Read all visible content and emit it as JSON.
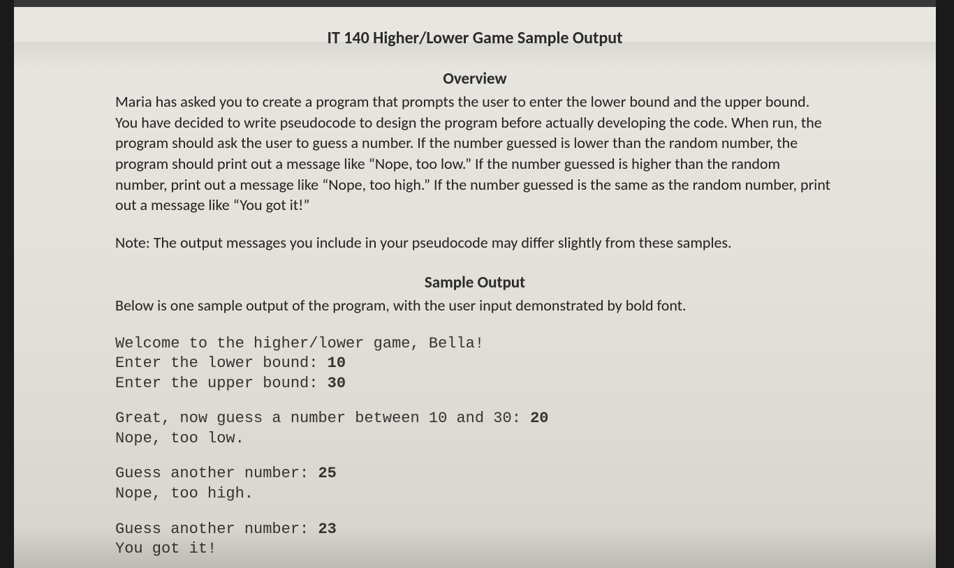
{
  "title": "IT 140 Higher/Lower Game Sample Output",
  "overview": {
    "heading": "Overview",
    "paragraph": "Maria has asked you to create a program that prompts the user to enter the lower bound and the upper bound. You have decided to write pseudocode to design the program before actually developing the code. When run, the program should ask the user to guess a number. If the number guessed is lower than the random number, the program should print out a message like “Nope, too low.” If the number guessed is higher than the random number, print out a message like “Nope, too high.” If the number guessed is the same as the random number, print out a message like “You got it!”",
    "note": "Note: The output messages you include in your pseudocode may differ slightly from these samples."
  },
  "sample": {
    "heading": "Sample Output",
    "intro": "Below is one sample output of the program, with the user input demonstrated by bold font.",
    "blocks": [
      [
        {
          "prompt": "Welcome to the higher/lower game, Bella!",
          "input": ""
        },
        {
          "prompt": "Enter the lower bound: ",
          "input": "10"
        },
        {
          "prompt": "Enter the upper bound: ",
          "input": "30"
        }
      ],
      [
        {
          "prompt": "Great, now guess a number between 10 and 30: ",
          "input": "20"
        },
        {
          "prompt": "Nope, too low.",
          "input": ""
        }
      ],
      [
        {
          "prompt": "Guess another number: ",
          "input": "25"
        },
        {
          "prompt": "Nope, too high.",
          "input": ""
        }
      ],
      [
        {
          "prompt": "Guess another number: ",
          "input": "23"
        },
        {
          "prompt": "You got it!",
          "input": ""
        }
      ]
    ]
  }
}
